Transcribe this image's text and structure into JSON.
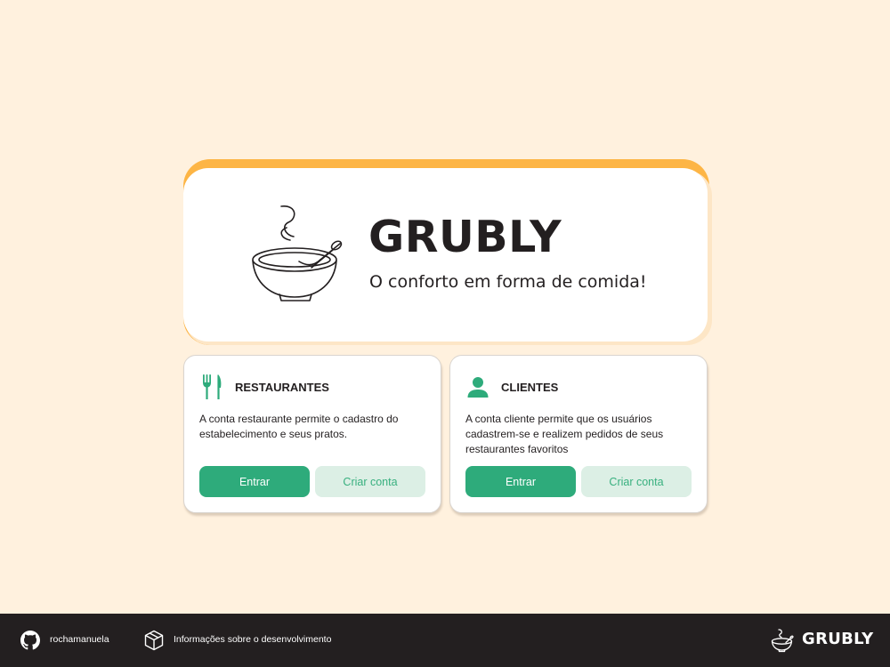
{
  "brand": {
    "name": "GRUBLY",
    "tagline": "O conforto em forma de comida!"
  },
  "cards": [
    {
      "title": "RESTAURANTES",
      "icon": "fork-knife-icon",
      "description": "A conta restaurante permite o cadastro do estabelecimento e seus pratos.",
      "primary_label": "Entrar",
      "secondary_label": "Criar conta"
    },
    {
      "title": "CLIENTES",
      "icon": "user-icon",
      "description": "A conta cliente permite que os usuários cadastrem-se e realizem pedidos de seus restaurantes favoritos",
      "primary_label": "Entrar",
      "secondary_label": "Criar conta"
    }
  ],
  "footer": {
    "github_label": "rochamanuela",
    "github_icon": "github-icon",
    "info_label": "Informações sobre o desenvolvimento",
    "info_icon": "box-icon",
    "logo_text": "GRUBLY",
    "logo_icon": "bowl-icon"
  },
  "colors": {
    "background": "#fff1de",
    "accent_orange": "#fdb545",
    "primary_green": "#2eab7b",
    "secondary_green_bg": "#dcefe5",
    "footer_bg": "#231f20"
  }
}
